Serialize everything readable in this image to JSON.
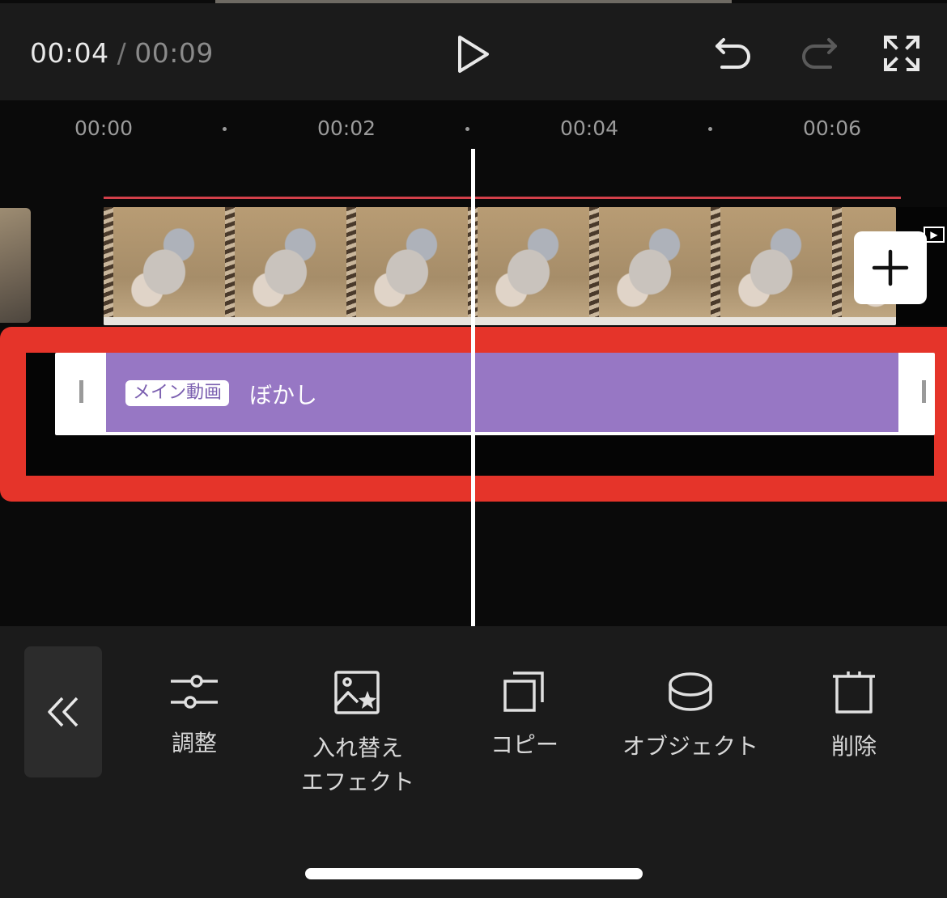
{
  "header": {
    "current_time": "00:04",
    "separator": "/",
    "total_time": "00:09"
  },
  "timeline": {
    "ruler": [
      "00:00",
      "00:02",
      "00:04",
      "00:06"
    ],
    "effect_clip": {
      "badge": "メイン動画",
      "name": "ぼかし"
    }
  },
  "toolbar": {
    "tools": [
      {
        "label": "調整"
      },
      {
        "label": "入れ替え\nエフェクト"
      },
      {
        "label": "コピー"
      },
      {
        "label": "オブジェクト"
      },
      {
        "label": "削除"
      }
    ]
  },
  "colors": {
    "highlight": "#e5342a",
    "effect_clip": "#9777c4",
    "red_line": "#d3404a"
  },
  "icons": [
    "play-icon",
    "undo-icon",
    "redo-icon",
    "fullscreen-icon",
    "plus-icon",
    "double-chevron-left-icon",
    "sliders-icon",
    "image-replace-icon",
    "copy-icon",
    "object-icon",
    "trash-icon"
  ]
}
